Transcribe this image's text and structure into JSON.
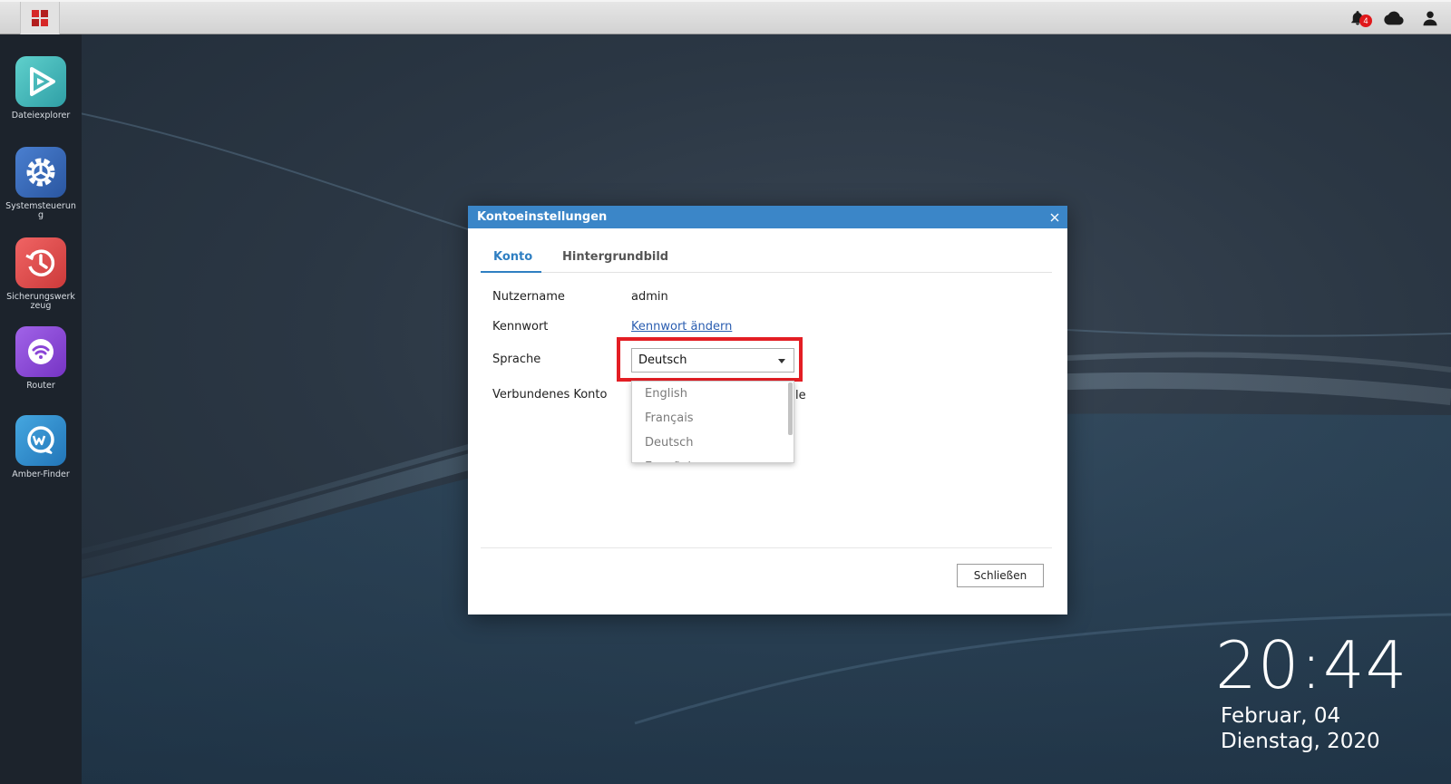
{
  "taskbar": {
    "notification_count": "4"
  },
  "dock": {
    "items": [
      {
        "label": "Dateiexplorer",
        "color": "#3fb9b6"
      },
      {
        "label": "Systemsteuerung",
        "color": "#3566b5"
      },
      {
        "label": "Sicherungswerkzeug",
        "color": "#e24b4b"
      },
      {
        "label": "Router",
        "color": "#8a45d6"
      },
      {
        "label": "Amber-Finder",
        "color": "#2f8fd0"
      }
    ]
  },
  "clock": {
    "time": "20:44",
    "date_line1": "Februar, 04",
    "date_line2": "Dienstag, 2020"
  },
  "dialog": {
    "title": "Kontoeinstellungen",
    "tabs": [
      {
        "label": "Konto",
        "active": true
      },
      {
        "label": "Hintergrundbild",
        "active": false
      }
    ],
    "fields": {
      "username_label": "Nutzername",
      "username_value": "admin",
      "password_label": "Kennwort",
      "password_link": "Kennwort ändern",
      "language_label": "Sprache",
      "language_selected": "Deutsch",
      "linked_account_label": "Verbundenes Konto",
      "linked_account_tail": "le"
    },
    "language_options": [
      "English",
      "Français",
      "Deutsch",
      "Español"
    ],
    "close_button": "Schließen"
  },
  "colors": {
    "dialog_header": "#3b86c8",
    "highlight": "#e31e24",
    "active_tab": "#2f7fc2"
  }
}
